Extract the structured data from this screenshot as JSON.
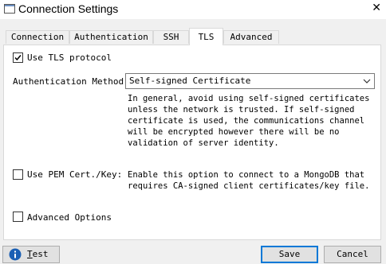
{
  "window": {
    "title": "Connection Settings",
    "close_glyph": "✕"
  },
  "tabs": [
    {
      "label": "Connection",
      "active": false
    },
    {
      "label": "Authentication",
      "active": false
    },
    {
      "label": "SSH",
      "active": false
    },
    {
      "label": "TLS",
      "active": true
    },
    {
      "label": "Advanced",
      "active": false
    }
  ],
  "tls": {
    "use_tls": {
      "label": "Use TLS protocol",
      "checked": true
    },
    "auth_method": {
      "label": "Authentication Method:",
      "selected": "Self-signed Certificate"
    },
    "auth_help": "In general, avoid using self-signed certificates\nunless the network is trusted. If self-signed\ncertificate is used, the communications channel\nwill be encrypted however there will be no\nvalidation of server identity.",
    "pem": {
      "label": "Use PEM Cert./Key:",
      "checked": false,
      "help": "Enable this option to connect to a MongoDB that\nrequires CA-signed client certificates/key file."
    },
    "advanced": {
      "label": "Advanced Options",
      "checked": false
    }
  },
  "buttons": {
    "test": {
      "pre": "",
      "underlined": "T",
      "post": "est"
    },
    "save": "Save",
    "cancel": "Cancel"
  },
  "colors": {
    "accent": "#0078d7",
    "info_icon": "#1a5fb4"
  },
  "icons": {
    "app": "window-app-icon",
    "close": "close-icon",
    "check": "checkmark-icon",
    "chevron": "chevron-down-icon",
    "info": "info-icon"
  }
}
